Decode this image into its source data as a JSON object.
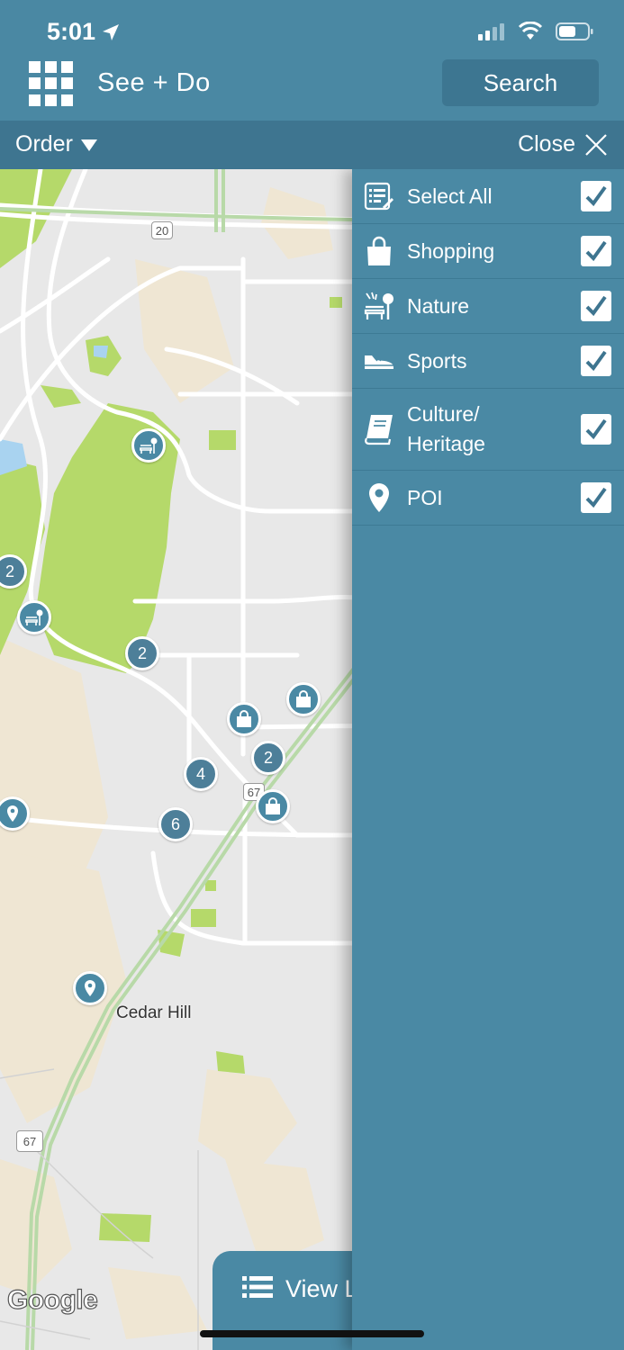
{
  "status": {
    "time": "5:01"
  },
  "header": {
    "title": "See + Do",
    "search_label": "Search"
  },
  "filterbar": {
    "order_label": "Order",
    "close_label": "Close"
  },
  "categories": [
    {
      "label": "Select All",
      "icon": "list-icon",
      "checked": true
    },
    {
      "label": "Shopping",
      "icon": "shopping-bag-icon",
      "checked": true
    },
    {
      "label": "Nature",
      "icon": "nature-bench-icon",
      "checked": true
    },
    {
      "label": "Sports",
      "icon": "sneaker-icon",
      "checked": true
    },
    {
      "label": "Culture/\nHeritage",
      "icon": "book-icon",
      "checked": true
    },
    {
      "label": "POI",
      "icon": "map-pin-icon",
      "checked": true
    }
  ],
  "map": {
    "city_label": "Cedar Hill",
    "highway_20": "20",
    "highway_67a": "67",
    "highway_67b": "67",
    "cluster_counts": [
      "2",
      "2",
      "4",
      "2",
      "6"
    ],
    "attribution": "Google"
  },
  "view_list_label": "View L",
  "colors": {
    "primary": "#4a88a3",
    "dark": "#3e7590",
    "park": "#b5d96a"
  }
}
